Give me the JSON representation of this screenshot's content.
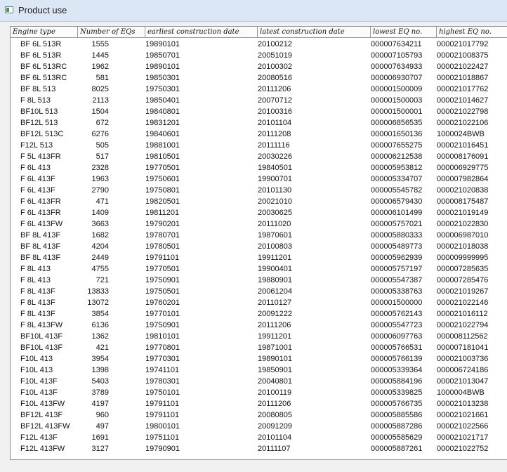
{
  "window": {
    "title": "Product use",
    "icon": "window-app-icon"
  },
  "table": {
    "columns": [
      "Engine type",
      "Number of EQs",
      "earliest construction date",
      "latest construction date",
      "lowest EQ no.",
      "highest EQ no."
    ],
    "rows": [
      [
        "BF 6L 513R",
        "1555",
        "19890101",
        "20100212",
        "000007634211",
        "000021017792"
      ],
      [
        "BF 6L 513R",
        "1445",
        "19850701",
        "20051019",
        "000007105793",
        "000021008375"
      ],
      [
        "BF 6L 513RC",
        "1962",
        "19890101",
        "20100302",
        "000007634933",
        "000021022427"
      ],
      [
        "BF 6L 513RC",
        "581",
        "19850301",
        "20080516",
        "000006930707",
        "000021018867"
      ],
      [
        "BF 8L 513",
        "8025",
        "19750301",
        "20111206",
        "000001500009",
        "000021017762"
      ],
      [
        "F 8L 513",
        "2113",
        "19850401",
        "20070712",
        "000001500003",
        "000021014627"
      ],
      [
        "BF10L 513",
        "1504",
        "19840801",
        "20100316",
        "000001500001",
        "000021022798"
      ],
      [
        "BF12L 513",
        "672",
        "19831201",
        "20101104",
        "000006856535",
        "000021022106"
      ],
      [
        "BF12L 513C",
        "6276",
        "19840601",
        "20111208",
        "000001650136",
        "1000024BWB"
      ],
      [
        "F12L 513",
        "505",
        "19881001",
        "20111116",
        "000007655275",
        "000021016451"
      ],
      [
        "F 5L 413FR",
        "517",
        "19810501",
        "20030226",
        "000006212538",
        "000008176091"
      ],
      [
        "F 6L 413",
        "2328",
        "19770501",
        "19840501",
        "000005953812",
        "000006929775"
      ],
      [
        "F 6L 413F",
        "1963",
        "19750601",
        "19900701",
        "000005334707",
        "000007982864"
      ],
      [
        "F 6L 413F",
        "2790",
        "19750801",
        "20101130",
        "000005545782",
        "000021020838"
      ],
      [
        "F 6L 413FR",
        "471",
        "19820501",
        "20021010",
        "000006579430",
        "000008175487"
      ],
      [
        "F 6L 413FR",
        "1409",
        "19811201",
        "20030625",
        "000006101499",
        "000021019149"
      ],
      [
        "F 6L 413FW",
        "3663",
        "19790201",
        "20111020",
        "000005757021",
        "000021022830"
      ],
      [
        "BF 8L 413F",
        "1682",
        "19780701",
        "19870601",
        "000005880333",
        "000006987010"
      ],
      [
        "BF 8L 413F",
        "4204",
        "19780501",
        "20100803",
        "000005489773",
        "000021018038"
      ],
      [
        "BF 8L 413F",
        "2449",
        "19791101",
        "19911201",
        "000005962939",
        "000009999995"
      ],
      [
        "F 8L 413",
        "4755",
        "19770501",
        "19900401",
        "000005757197",
        "000007285635"
      ],
      [
        "F 8L 413",
        "721",
        "19750901",
        "19880901",
        "000005547387",
        "000007285476"
      ],
      [
        "F 8L 413F",
        "13833",
        "19750501",
        "20061204",
        "000005338763",
        "000021019267"
      ],
      [
        "F 8L 413F",
        "13072",
        "19760201",
        "20110127",
        "000001500000",
        "000021022146"
      ],
      [
        "F 8L 413F",
        "3854",
        "19770101",
        "20091222",
        "000005762143",
        "000021016112"
      ],
      [
        "F 8L 413FW",
        "6136",
        "19750901",
        "20111206",
        "000005547723",
        "000021022794"
      ],
      [
        "BF10L 413F",
        "1362",
        "19810101",
        "19911201",
        "000006097763",
        "000008112562"
      ],
      [
        "BF10L 413F",
        "421",
        "19770801",
        "19871001",
        "000005766531",
        "000007181041"
      ],
      [
        "F10L 413",
        "3954",
        "19770301",
        "19890101",
        "000005766139",
        "000021003736"
      ],
      [
        "F10L 413",
        "1398",
        "19741101",
        "19850901",
        "000005339364",
        "000006724186"
      ],
      [
        "F10L 413F",
        "5403",
        "19780301",
        "20040801",
        "000005884196",
        "000021013047"
      ],
      [
        "F10L 413F",
        "3789",
        "19750101",
        "20100119",
        "000005339825",
        "1000004BWB"
      ],
      [
        "F10L 413FW",
        "4197",
        "19791101",
        "20111206",
        "000005766735",
        "000021013238"
      ],
      [
        "BF12L 413F",
        "960",
        "19791101",
        "20080805",
        "000005885586",
        "000021021661"
      ],
      [
        "BF12L 413FW",
        "497",
        "19800101",
        "20091209",
        "000005887286",
        "000021022566"
      ],
      [
        "F12L 413F",
        "1691",
        "19751101",
        "20101104",
        "000005585629",
        "000021021717"
      ],
      [
        "F12L 413FW",
        "3127",
        "19790901",
        "20111107",
        "000005887261",
        "000021022752"
      ]
    ]
  }
}
